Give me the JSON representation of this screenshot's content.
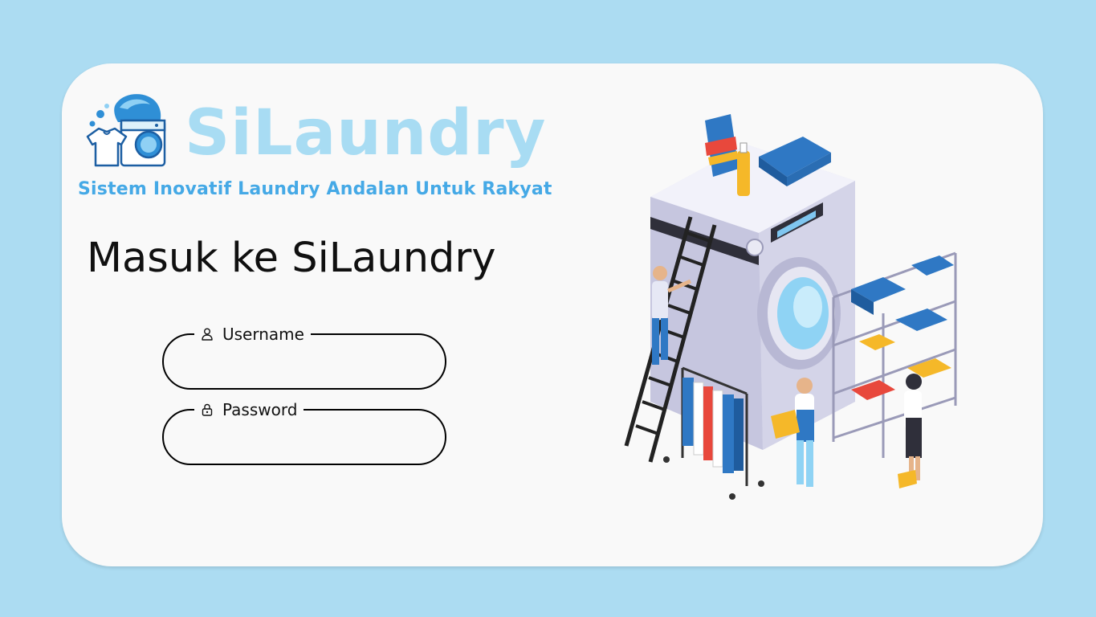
{
  "brand": {
    "name": "SiLaundry",
    "tagline": "Sistem Inovatif Laundry Andalan Untuk Rakyat",
    "logo_icon": "washing-machine-shirt-logo",
    "color_primary": "#a8dcf3",
    "color_tagline": "#45a9e6"
  },
  "login": {
    "title": "Masuk ke SiLaundry",
    "username_label": "Username",
    "username_icon": "user-icon",
    "username_value": "",
    "password_label": "Password",
    "password_icon": "lock-icon",
    "password_value": ""
  },
  "illustration": {
    "icon": "laundry-scene-illustration"
  },
  "colors": {
    "page_background": "#acdcf2",
    "card_background": "#f9f9f9"
  }
}
